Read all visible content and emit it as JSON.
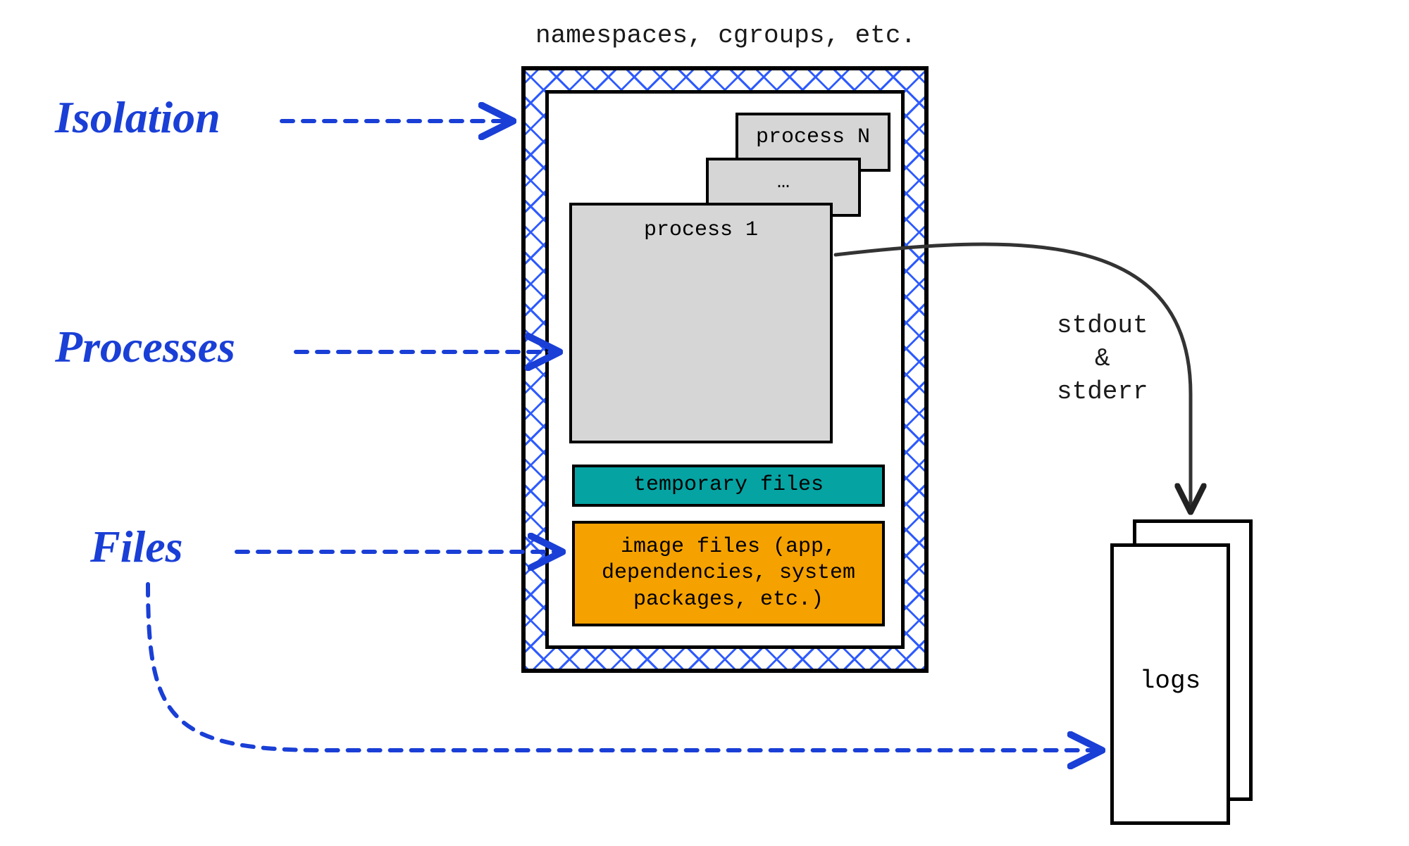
{
  "title": "Container anatomy diagram",
  "labels": {
    "namespaces_hdr": "namespaces, cgroups, etc.",
    "isolation": "Isolation",
    "processes": "Processes",
    "files": "Files",
    "stdout_stderr": "stdout\n&\nstderr",
    "logs": "logs"
  },
  "boxes": {
    "process_n": "process N",
    "process_dots": "…",
    "process_1": "process 1",
    "temp_files": "temporary files",
    "image_files": "image files\n(app, dependencies,\nsystem packages, etc.)"
  },
  "colors": {
    "accent_blue": "#1a3fd6",
    "hatch_blue": "#2e5bff",
    "teal": "#06a3a3",
    "orange": "#f5a100",
    "process_grey": "#d6d6d6"
  }
}
